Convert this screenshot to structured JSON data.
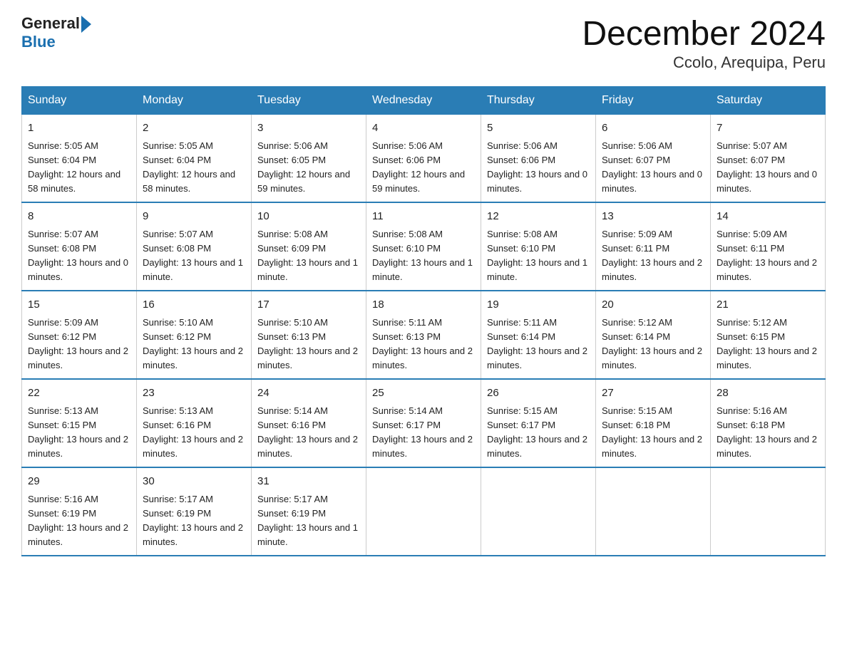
{
  "header": {
    "logo_general": "General",
    "logo_blue": "Blue",
    "title": "December 2024",
    "subtitle": "Ccolo, Arequipa, Peru"
  },
  "days_of_week": [
    "Sunday",
    "Monday",
    "Tuesday",
    "Wednesday",
    "Thursday",
    "Friday",
    "Saturday"
  ],
  "weeks": [
    [
      {
        "day": "1",
        "sunrise": "5:05 AM",
        "sunset": "6:04 PM",
        "daylight": "12 hours and 58 minutes."
      },
      {
        "day": "2",
        "sunrise": "5:05 AM",
        "sunset": "6:04 PM",
        "daylight": "12 hours and 58 minutes."
      },
      {
        "day": "3",
        "sunrise": "5:06 AM",
        "sunset": "6:05 PM",
        "daylight": "12 hours and 59 minutes."
      },
      {
        "day": "4",
        "sunrise": "5:06 AM",
        "sunset": "6:06 PM",
        "daylight": "12 hours and 59 minutes."
      },
      {
        "day": "5",
        "sunrise": "5:06 AM",
        "sunset": "6:06 PM",
        "daylight": "13 hours and 0 minutes."
      },
      {
        "day": "6",
        "sunrise": "5:06 AM",
        "sunset": "6:07 PM",
        "daylight": "13 hours and 0 minutes."
      },
      {
        "day": "7",
        "sunrise": "5:07 AM",
        "sunset": "6:07 PM",
        "daylight": "13 hours and 0 minutes."
      }
    ],
    [
      {
        "day": "8",
        "sunrise": "5:07 AM",
        "sunset": "6:08 PM",
        "daylight": "13 hours and 0 minutes."
      },
      {
        "day": "9",
        "sunrise": "5:07 AM",
        "sunset": "6:08 PM",
        "daylight": "13 hours and 1 minute."
      },
      {
        "day": "10",
        "sunrise": "5:08 AM",
        "sunset": "6:09 PM",
        "daylight": "13 hours and 1 minute."
      },
      {
        "day": "11",
        "sunrise": "5:08 AM",
        "sunset": "6:10 PM",
        "daylight": "13 hours and 1 minute."
      },
      {
        "day": "12",
        "sunrise": "5:08 AM",
        "sunset": "6:10 PM",
        "daylight": "13 hours and 1 minute."
      },
      {
        "day": "13",
        "sunrise": "5:09 AM",
        "sunset": "6:11 PM",
        "daylight": "13 hours and 2 minutes."
      },
      {
        "day": "14",
        "sunrise": "5:09 AM",
        "sunset": "6:11 PM",
        "daylight": "13 hours and 2 minutes."
      }
    ],
    [
      {
        "day": "15",
        "sunrise": "5:09 AM",
        "sunset": "6:12 PM",
        "daylight": "13 hours and 2 minutes."
      },
      {
        "day": "16",
        "sunrise": "5:10 AM",
        "sunset": "6:12 PM",
        "daylight": "13 hours and 2 minutes."
      },
      {
        "day": "17",
        "sunrise": "5:10 AM",
        "sunset": "6:13 PM",
        "daylight": "13 hours and 2 minutes."
      },
      {
        "day": "18",
        "sunrise": "5:11 AM",
        "sunset": "6:13 PM",
        "daylight": "13 hours and 2 minutes."
      },
      {
        "day": "19",
        "sunrise": "5:11 AM",
        "sunset": "6:14 PM",
        "daylight": "13 hours and 2 minutes."
      },
      {
        "day": "20",
        "sunrise": "5:12 AM",
        "sunset": "6:14 PM",
        "daylight": "13 hours and 2 minutes."
      },
      {
        "day": "21",
        "sunrise": "5:12 AM",
        "sunset": "6:15 PM",
        "daylight": "13 hours and 2 minutes."
      }
    ],
    [
      {
        "day": "22",
        "sunrise": "5:13 AM",
        "sunset": "6:15 PM",
        "daylight": "13 hours and 2 minutes."
      },
      {
        "day": "23",
        "sunrise": "5:13 AM",
        "sunset": "6:16 PM",
        "daylight": "13 hours and 2 minutes."
      },
      {
        "day": "24",
        "sunrise": "5:14 AM",
        "sunset": "6:16 PM",
        "daylight": "13 hours and 2 minutes."
      },
      {
        "day": "25",
        "sunrise": "5:14 AM",
        "sunset": "6:17 PM",
        "daylight": "13 hours and 2 minutes."
      },
      {
        "day": "26",
        "sunrise": "5:15 AM",
        "sunset": "6:17 PM",
        "daylight": "13 hours and 2 minutes."
      },
      {
        "day": "27",
        "sunrise": "5:15 AM",
        "sunset": "6:18 PM",
        "daylight": "13 hours and 2 minutes."
      },
      {
        "day": "28",
        "sunrise": "5:16 AM",
        "sunset": "6:18 PM",
        "daylight": "13 hours and 2 minutes."
      }
    ],
    [
      {
        "day": "29",
        "sunrise": "5:16 AM",
        "sunset": "6:19 PM",
        "daylight": "13 hours and 2 minutes."
      },
      {
        "day": "30",
        "sunrise": "5:17 AM",
        "sunset": "6:19 PM",
        "daylight": "13 hours and 2 minutes."
      },
      {
        "day": "31",
        "sunrise": "5:17 AM",
        "sunset": "6:19 PM",
        "daylight": "13 hours and 1 minute."
      },
      null,
      null,
      null,
      null
    ]
  ]
}
